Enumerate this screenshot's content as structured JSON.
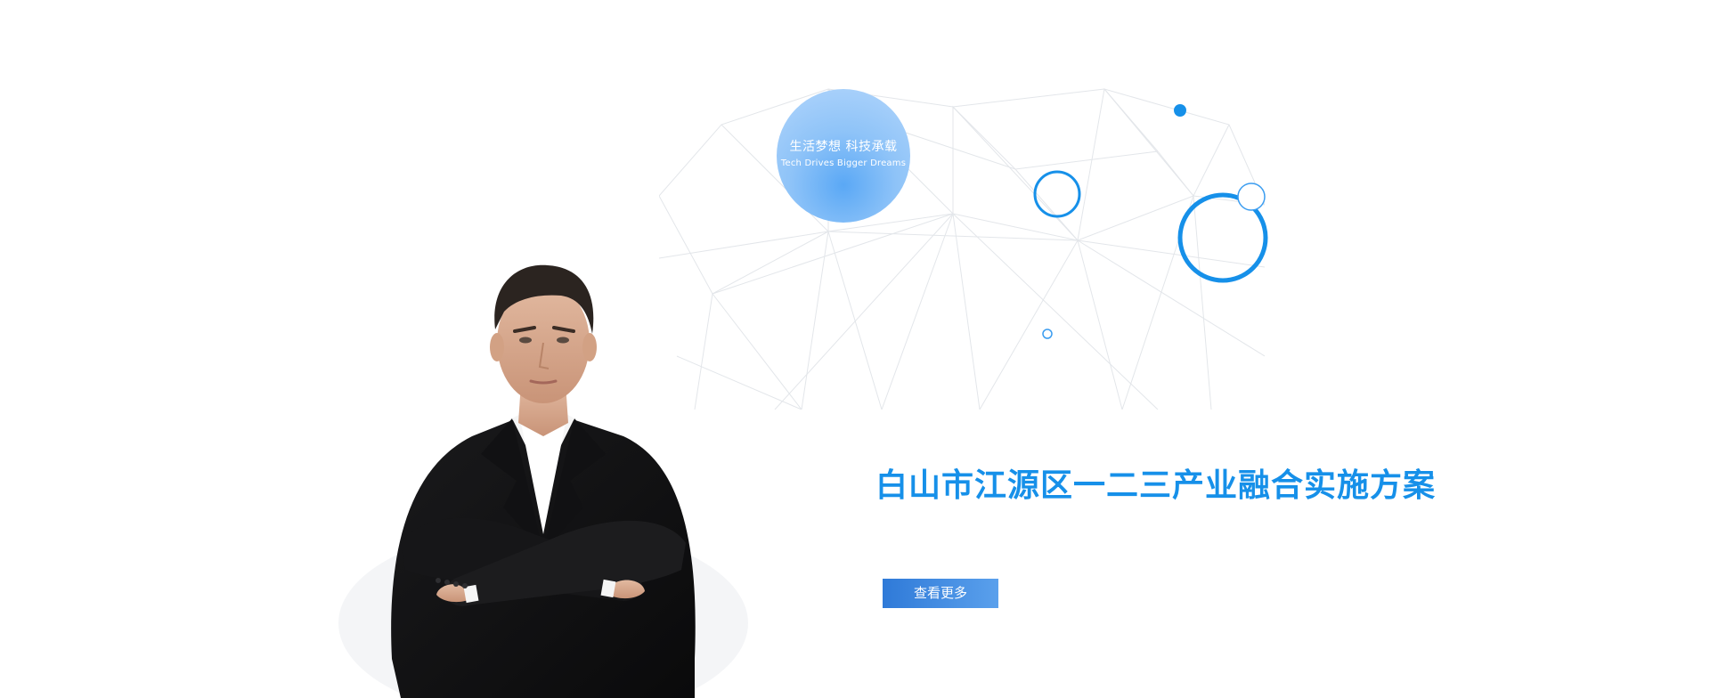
{
  "badge": {
    "title": "生活梦想 科技承载",
    "subtitle": "Tech Drives Bigger Dreams"
  },
  "headline": "白山市江源区一二三产业融合实施方案",
  "more_button": {
    "label": "查看更多"
  },
  "colors": {
    "accent": "#1690e9",
    "button_start": "#2f7ad8",
    "button_end": "#5aa0ec",
    "badge": "#8ec3f8",
    "mesh_lines": "#e3e6ea"
  }
}
